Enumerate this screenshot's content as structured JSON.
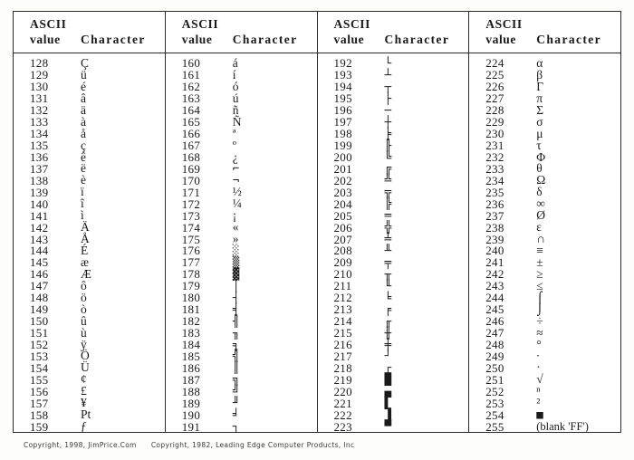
{
  "document": {
    "title": "ASCII Extended Character Set Table",
    "columns": [
      {
        "header": {
          "line1": "ASCII",
          "line2_value": "value",
          "line2_character": "Character"
        },
        "rows": [
          {
            "value": "128",
            "char": "Ç",
            "style": "serifchar"
          },
          {
            "value": "129",
            "char": "ü",
            "style": "serifchar"
          },
          {
            "value": "130",
            "char": "é",
            "style": "serifchar"
          },
          {
            "value": "131",
            "char": "â",
            "style": "serifchar"
          },
          {
            "value": "132",
            "char": "ä",
            "style": "serifchar"
          },
          {
            "value": "133",
            "char": "à",
            "style": "serifchar"
          },
          {
            "value": "134",
            "char": "å",
            "style": "serifchar"
          },
          {
            "value": "135",
            "char": "ç",
            "style": "serifchar"
          },
          {
            "value": "136",
            "char": "ê",
            "style": "serifchar"
          },
          {
            "value": "137",
            "char": "ë",
            "style": "serifchar"
          },
          {
            "value": "138",
            "char": "è",
            "style": "serifchar"
          },
          {
            "value": "139",
            "char": "ï",
            "style": "serifchar"
          },
          {
            "value": "140",
            "char": "î",
            "style": "serifchar"
          },
          {
            "value": "141",
            "char": "ì",
            "style": "serifchar"
          },
          {
            "value": "142",
            "char": "Ä",
            "style": "serifchar"
          },
          {
            "value": "143",
            "char": "Å",
            "style": "serifchar"
          },
          {
            "value": "144",
            "char": "É",
            "style": "serifchar"
          },
          {
            "value": "145",
            "char": "æ",
            "style": "serifchar"
          },
          {
            "value": "146",
            "char": "Æ",
            "style": "serifchar"
          },
          {
            "value": "147",
            "char": "ô",
            "style": "serifchar"
          },
          {
            "value": "148",
            "char": "ö",
            "style": "serifchar"
          },
          {
            "value": "149",
            "char": "ò",
            "style": "serifchar"
          },
          {
            "value": "150",
            "char": "û",
            "style": "serifchar"
          },
          {
            "value": "151",
            "char": "ù",
            "style": "serifchar"
          },
          {
            "value": "152",
            "char": "ÿ",
            "style": "serifchar"
          },
          {
            "value": "153",
            "char": "Ö",
            "style": "serifchar"
          },
          {
            "value": "154",
            "char": "Ü",
            "style": "serifchar"
          },
          {
            "value": "155",
            "char": "¢",
            "style": "serifchar"
          },
          {
            "value": "156",
            "char": "£",
            "style": "serifchar"
          },
          {
            "value": "157",
            "char": "¥",
            "style": "serifchar"
          },
          {
            "value": "158",
            "char": "Pt",
            "style": "serifchar"
          },
          {
            "value": "159",
            "char": "ƒ",
            "style": "serifchar"
          }
        ]
      },
      {
        "header": {
          "line1": "ASCII",
          "line2_value": "value",
          "line2_character": "Character"
        },
        "rows": [
          {
            "value": "160",
            "char": "á",
            "style": "serifchar"
          },
          {
            "value": "161",
            "char": "í",
            "style": "serifchar"
          },
          {
            "value": "162",
            "char": "ó",
            "style": "serifchar"
          },
          {
            "value": "163",
            "char": "ú",
            "style": "serifchar"
          },
          {
            "value": "164",
            "char": "ñ",
            "style": "serifchar"
          },
          {
            "value": "165",
            "char": "Ñ",
            "style": "serifchar"
          },
          {
            "value": "166",
            "char": "ª",
            "style": "serifchar"
          },
          {
            "value": "167",
            "char": "º",
            "style": "serifchar"
          },
          {
            "value": "168",
            "char": "¿",
            "style": "serifchar"
          },
          {
            "value": "169",
            "char": "⌐",
            "style": "box"
          },
          {
            "value": "170",
            "char": "¬",
            "style": "box"
          },
          {
            "value": "171",
            "char": "½",
            "style": "serifchar"
          },
          {
            "value": "172",
            "char": "¼",
            "style": "serifchar"
          },
          {
            "value": "173",
            "char": "¡",
            "style": "serifchar"
          },
          {
            "value": "174",
            "char": "«",
            "style": "serifchar"
          },
          {
            "value": "175",
            "char": "»",
            "style": "serifchar"
          },
          {
            "value": "176",
            "char": "░",
            "style": "blockchar"
          },
          {
            "value": "177",
            "char": "▒",
            "style": "blockchar"
          },
          {
            "value": "178",
            "char": "▓",
            "style": "blockchar"
          },
          {
            "value": "179",
            "char": "│",
            "style": "box"
          },
          {
            "value": "180",
            "char": "┤",
            "style": "box"
          },
          {
            "value": "181",
            "char": "╡",
            "style": "box"
          },
          {
            "value": "182",
            "char": "╢",
            "style": "box"
          },
          {
            "value": "183",
            "char": "╖",
            "style": "box"
          },
          {
            "value": "184",
            "char": "╕",
            "style": "box"
          },
          {
            "value": "185",
            "char": "╣",
            "style": "box"
          },
          {
            "value": "186",
            "char": "║",
            "style": "box"
          },
          {
            "value": "187",
            "char": "╗",
            "style": "box"
          },
          {
            "value": "188",
            "char": "╝",
            "style": "box"
          },
          {
            "value": "189",
            "char": "╜",
            "style": "box"
          },
          {
            "value": "190",
            "char": "╛",
            "style": "box"
          },
          {
            "value": "191",
            "char": "┐",
            "style": "box"
          }
        ]
      },
      {
        "header": {
          "line1": "ASCII",
          "line2_value": "value",
          "line2_character": "Character"
        },
        "rows": [
          {
            "value": "192",
            "char": "└",
            "style": "box"
          },
          {
            "value": "193",
            "char": "┴",
            "style": "box"
          },
          {
            "value": "194",
            "char": "┬",
            "style": "box"
          },
          {
            "value": "195",
            "char": "├",
            "style": "box"
          },
          {
            "value": "196",
            "char": "─",
            "style": "box"
          },
          {
            "value": "197",
            "char": "┼",
            "style": "box"
          },
          {
            "value": "198",
            "char": "╞",
            "style": "box"
          },
          {
            "value": "199",
            "char": "╟",
            "style": "box"
          },
          {
            "value": "200",
            "char": "╚",
            "style": "box"
          },
          {
            "value": "201",
            "char": "╔",
            "style": "box"
          },
          {
            "value": "202",
            "char": "╩",
            "style": "box"
          },
          {
            "value": "203",
            "char": "╦",
            "style": "box"
          },
          {
            "value": "204",
            "char": "╠",
            "style": "box"
          },
          {
            "value": "205",
            "char": "═",
            "style": "box"
          },
          {
            "value": "206",
            "char": "╬",
            "style": "box"
          },
          {
            "value": "207",
            "char": "╧",
            "style": "box"
          },
          {
            "value": "208",
            "char": "╨",
            "style": "box"
          },
          {
            "value": "209",
            "char": "╤",
            "style": "box"
          },
          {
            "value": "210",
            "char": "╥",
            "style": "box"
          },
          {
            "value": "211",
            "char": "╙",
            "style": "box"
          },
          {
            "value": "212",
            "char": "╘",
            "style": "box"
          },
          {
            "value": "213",
            "char": "╒",
            "style": "box"
          },
          {
            "value": "214",
            "char": "╓",
            "style": "box"
          },
          {
            "value": "215",
            "char": "╫",
            "style": "box"
          },
          {
            "value": "216",
            "char": "╪",
            "style": "box"
          },
          {
            "value": "217",
            "char": "┘",
            "style": "box"
          },
          {
            "value": "218",
            "char": "┌",
            "style": "box"
          },
          {
            "value": "219",
            "char": "█",
            "style": "blockchar"
          },
          {
            "value": "220",
            "char": "▄",
            "style": "blockchar"
          },
          {
            "value": "221",
            "char": "▌",
            "style": "blockchar"
          },
          {
            "value": "222",
            "char": "▐",
            "style": "blockchar"
          },
          {
            "value": "223",
            "char": "▀",
            "style": "blockchar"
          }
        ]
      },
      {
        "header": {
          "line1": "ASCII",
          "line2_value": "value",
          "line2_character": "Character"
        },
        "rows": [
          {
            "value": "224",
            "char": "α",
            "style": "serifchar"
          },
          {
            "value": "225",
            "char": "β",
            "style": "serifchar"
          },
          {
            "value": "226",
            "char": "Γ",
            "style": "serifchar"
          },
          {
            "value": "227",
            "char": "π",
            "style": "serifchar"
          },
          {
            "value": "228",
            "char": "Σ",
            "style": "serifchar"
          },
          {
            "value": "229",
            "char": "σ",
            "style": "serifchar"
          },
          {
            "value": "230",
            "char": "μ",
            "style": "serifchar"
          },
          {
            "value": "231",
            "char": "τ",
            "style": "serifchar"
          },
          {
            "value": "232",
            "char": "Φ",
            "style": "serifchar"
          },
          {
            "value": "233",
            "char": "θ",
            "style": "serifchar"
          },
          {
            "value": "234",
            "char": "Ω",
            "style": "serifchar"
          },
          {
            "value": "235",
            "char": "δ",
            "style": "serifchar"
          },
          {
            "value": "236",
            "char": "∞",
            "style": "serifchar"
          },
          {
            "value": "237",
            "char": "Ø",
            "style": "serifchar"
          },
          {
            "value": "238",
            "char": "ε",
            "style": "serifchar"
          },
          {
            "value": "239",
            "char": "∩",
            "style": "serifchar"
          },
          {
            "value": "240",
            "char": "≡",
            "style": "serifchar"
          },
          {
            "value": "241",
            "char": "±",
            "style": "serifchar"
          },
          {
            "value": "242",
            "char": "≥",
            "style": "serifchar"
          },
          {
            "value": "243",
            "char": "≤",
            "style": "serifchar"
          },
          {
            "value": "244",
            "char": "⌠",
            "style": "box"
          },
          {
            "value": "245",
            "char": "⌡",
            "style": "box"
          },
          {
            "value": "246",
            "char": "÷",
            "style": "serifchar"
          },
          {
            "value": "247",
            "char": "≈",
            "style": "serifchar"
          },
          {
            "value": "248",
            "char": "°",
            "style": "serifchar"
          },
          {
            "value": "249",
            "char": "∙",
            "style": "serifchar"
          },
          {
            "value": "250",
            "char": "·",
            "style": "serifchar"
          },
          {
            "value": "251",
            "char": "√",
            "style": "serifchar"
          },
          {
            "value": "252",
            "char": "ⁿ",
            "style": "serifchar"
          },
          {
            "value": "253",
            "char": "²",
            "style": "serifchar"
          },
          {
            "value": "254",
            "char": "■",
            "style": "blockchar"
          },
          {
            "value": "255",
            "char": "(blank 'FF')",
            "style": "note"
          }
        ]
      }
    ],
    "footer": {
      "copyright_left": "Copyright, 1998, JimPrice.Com",
      "copyright_right": "Copyright, 1982, Leading Edge Computer Products, Inc"
    }
  }
}
